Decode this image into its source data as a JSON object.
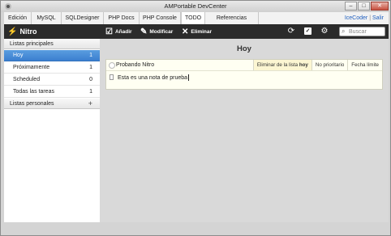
{
  "window": {
    "title": "AMPortable DevCenter",
    "controls": [
      "–",
      "□",
      "✕"
    ]
  },
  "tabs": [
    {
      "label": "Edición",
      "active": false
    },
    {
      "label": "MySQL",
      "active": false
    },
    {
      "label": "SQLDesigner",
      "active": false
    },
    {
      "label": "PHP Docs",
      "active": false
    },
    {
      "label": "PHP Console",
      "active": false
    },
    {
      "label": "TODO",
      "active": true
    },
    {
      "label": "Referencias Online",
      "active": false
    }
  ],
  "tab_links": {
    "icecoder": "IceCoder",
    "separator": "|",
    "exit": "Salir"
  },
  "toolbar": {
    "brand": "Nitro",
    "brand_icon": "lightning-bolt-icon",
    "add_label": "Añadir",
    "edit_label": "Modificar",
    "delete_label": "Eliminar",
    "search_placeholder": "Buscar",
    "icons": [
      "sync-icon",
      "checklist-icon",
      "settings-icon"
    ]
  },
  "sidebar": {
    "main_header": "Listas principales",
    "items": [
      {
        "label": "Hoy",
        "count": "1",
        "active": true
      },
      {
        "label": "Próximamente",
        "count": "1",
        "active": false
      },
      {
        "label": "Scheduled",
        "count": "0",
        "active": false
      },
      {
        "label": "Todas las tareas",
        "count": "1",
        "active": false
      }
    ],
    "personal_header": "Listas personales",
    "personal_add": "+"
  },
  "main": {
    "title": "Hoy",
    "task": {
      "name": "Probando Nitro",
      "list_prefix": "Eliminar de la lista",
      "list_name": "hoy",
      "priority": "No prioritario",
      "date": "Fecha límite",
      "note": "Esta es una nota de prueba"
    }
  },
  "colors": {
    "toolbar_bg": "#2b2b2b",
    "active_item": "#3b7fcf",
    "task_bg": "#fffff2",
    "link": "#1f5fbf"
  }
}
